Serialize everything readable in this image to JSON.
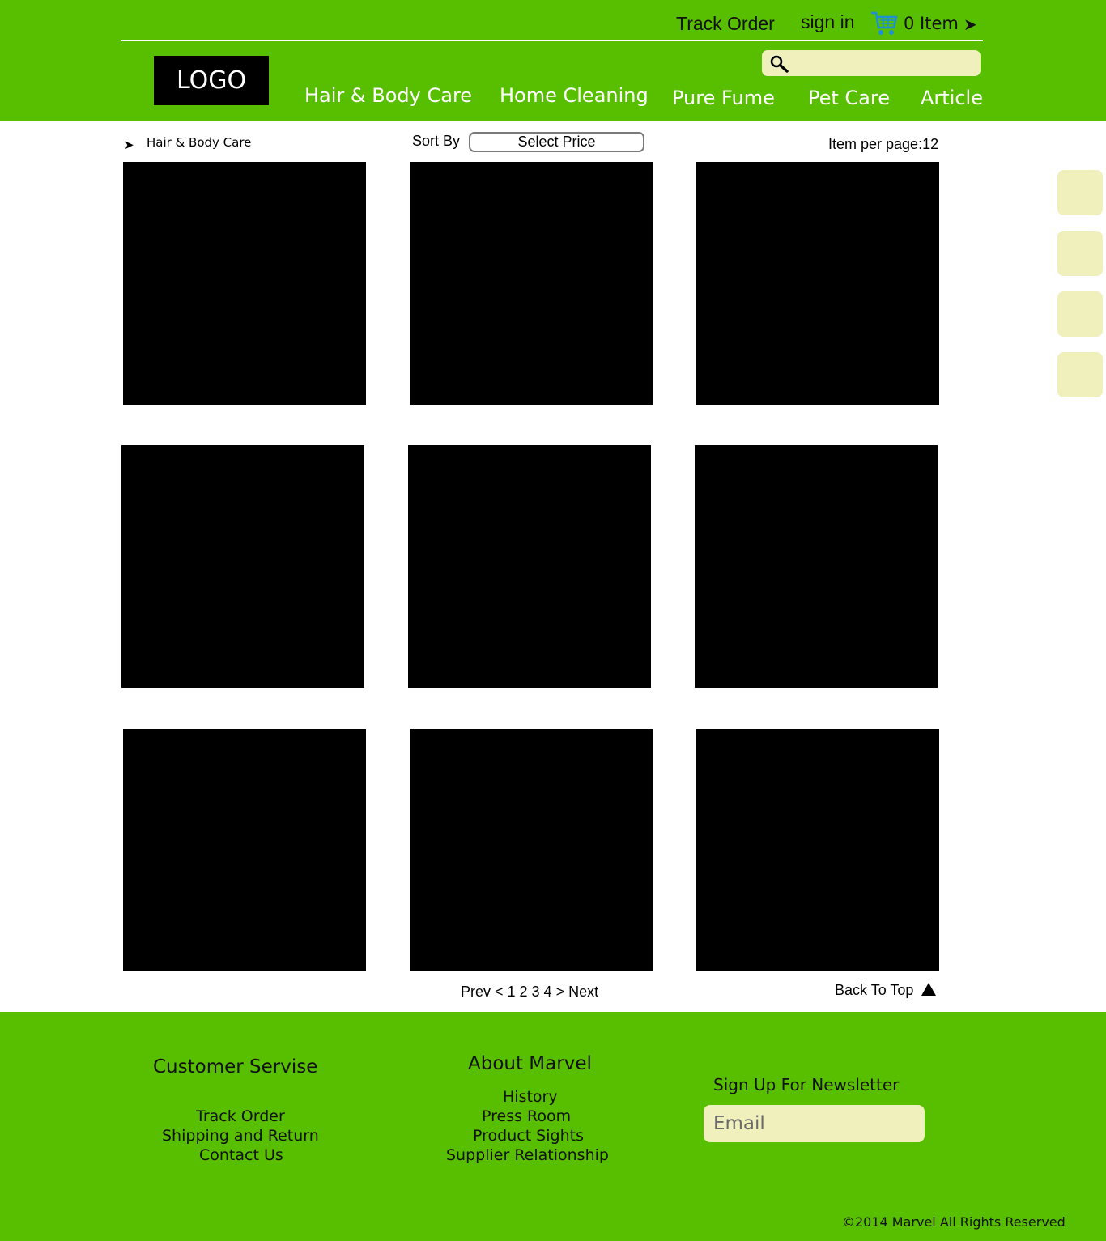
{
  "colors": {
    "brand_green": "#57bf00",
    "input_bg": "#f0f0bd",
    "tile": "#000000",
    "nav_text": "#ffffff"
  },
  "topbar": {
    "track_order": "Track Order",
    "sign_in": "sign in",
    "cart_count": "0 Item",
    "cart_arrow": "➤",
    "cart_icon": "shopping-cart-icon"
  },
  "header": {
    "logo": "LOGO",
    "search_icon": "magnifier-icon",
    "nav": [
      "Hair & Body Care",
      "Home Cleaning",
      "Pure Fume",
      "Pet Care",
      "Article"
    ]
  },
  "toolbar": {
    "breadcrumb_arrow": "➤",
    "breadcrumb": "Hair & Body Care",
    "sort_label": "Sort By",
    "sort_value": "Select Price",
    "per_page": "Item per page:12"
  },
  "product_grid": {
    "count": 9
  },
  "side_buttons": {
    "count": 4
  },
  "pagination": {
    "text": "Prev < 1 2 3 4 > Next"
  },
  "back_to_top": {
    "label": "Back To Top",
    "icon": "triangle-up-icon"
  },
  "footer": {
    "customer_service": {
      "title": "Customer Servise",
      "links": [
        "Track Order",
        "Shipping and Return",
        "Contact Us"
      ]
    },
    "about": {
      "title": "About Marvel",
      "links": [
        "History",
        "Press Room",
        "Product Sights",
        "Supplier Relationship"
      ]
    },
    "newsletter": {
      "title": "Sign Up For Newsletter",
      "placeholder": "Email"
    },
    "copyright": "©2014 Marvel  All Rights Reserved"
  }
}
